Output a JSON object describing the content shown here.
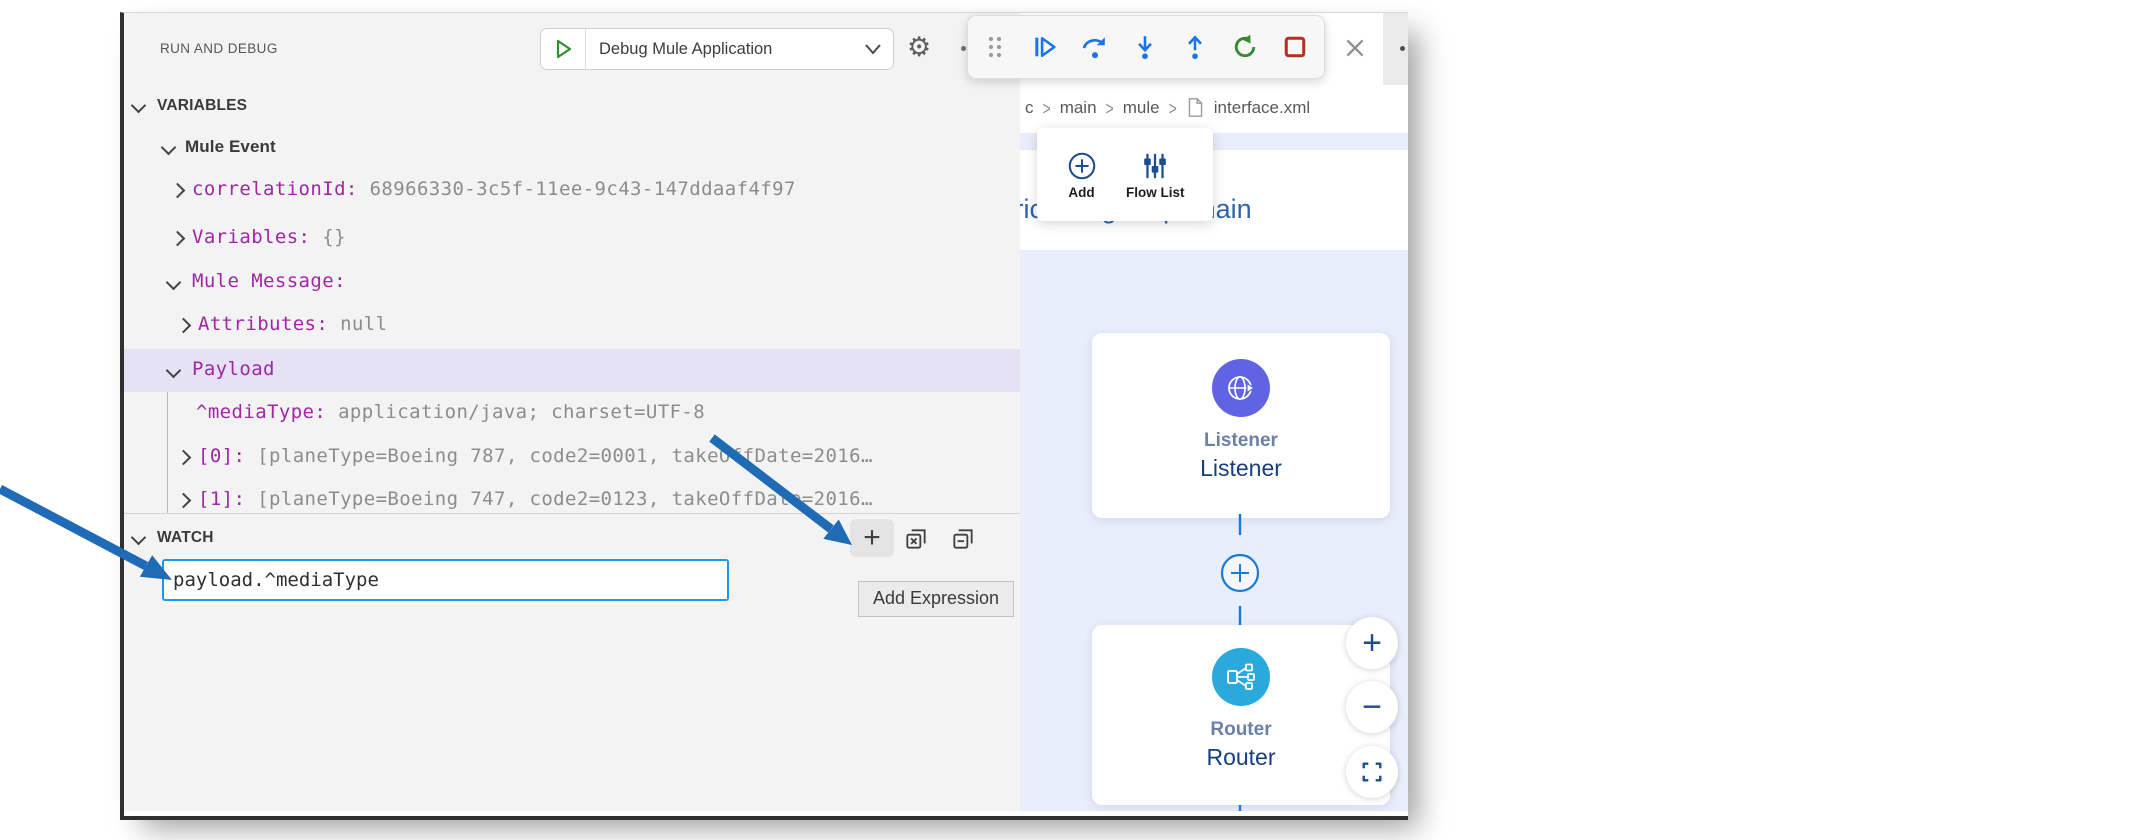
{
  "debug_panel": {
    "title": "RUN AND DEBUG",
    "run_config": {
      "label": "Debug Mule Application"
    },
    "variables": {
      "header": "VARIABLES",
      "rows": [
        {
          "key": "Mule Event",
          "value": ""
        },
        {
          "key": "correlationId:",
          "value": "68966330-3c5f-11ee-9c43-147ddaaf4f97"
        },
        {
          "key": "Variables:",
          "value": "{}"
        },
        {
          "key": "Mule Message:",
          "value": ""
        },
        {
          "key": "Attributes:",
          "value": "null"
        },
        {
          "key": "Payload",
          "value": ""
        },
        {
          "key": "^mediaType:",
          "value": "application/java; charset=UTF-8"
        },
        {
          "key": "[0]:",
          "value": "[planeType=Boeing 787, code2=0001, takeOffDate=2016…"
        },
        {
          "key": "[1]:",
          "value": "[planeType=Boeing 747, code2=0123, takeOffDate=2016…"
        }
      ]
    },
    "watch": {
      "header": "WATCH",
      "input_value": "payload.^mediaType",
      "buttons": [
        "add-expression",
        "remove-all-expressions",
        "collapse-all"
      ],
      "tooltip": "Add Expression"
    }
  },
  "debug_toolbar": {
    "buttons": [
      "drag-handle",
      "continue",
      "step-over",
      "step-into",
      "step-out",
      "restart",
      "stop"
    ]
  },
  "editor": {
    "breadcrumb": {
      "items": [
        "c",
        "main",
        "mule"
      ],
      "file": "interface.xml"
    },
    "canvas_toolbar": {
      "add_label": "Add",
      "flow_list_label": "Flow List"
    },
    "flow_title": "american-flight-api-main",
    "nodes": {
      "listener": {
        "type_label": "Listener",
        "name": "Listener"
      },
      "router": {
        "type_label": "Router",
        "name": "Router"
      }
    }
  },
  "icons": {
    "gear": "⚙",
    "watch_add": "+",
    "zoom_in": "+",
    "zoom_out": "−"
  },
  "colors": {
    "accent_blue": "#1a73e8",
    "success_green": "#388a34",
    "stop_red": "#b4301f",
    "annotation_blue": "#1f6bb5",
    "canvas_blue": "#e9eefb",
    "highlight_lavender": "#e4e2f4",
    "focus_border": "#1e95ef",
    "node_indigo": "#6064e3",
    "node_cyan": "#2aa9dd",
    "toolbar_navy": "#1b4e8e",
    "flow_title_blue": "#2d63ae"
  }
}
